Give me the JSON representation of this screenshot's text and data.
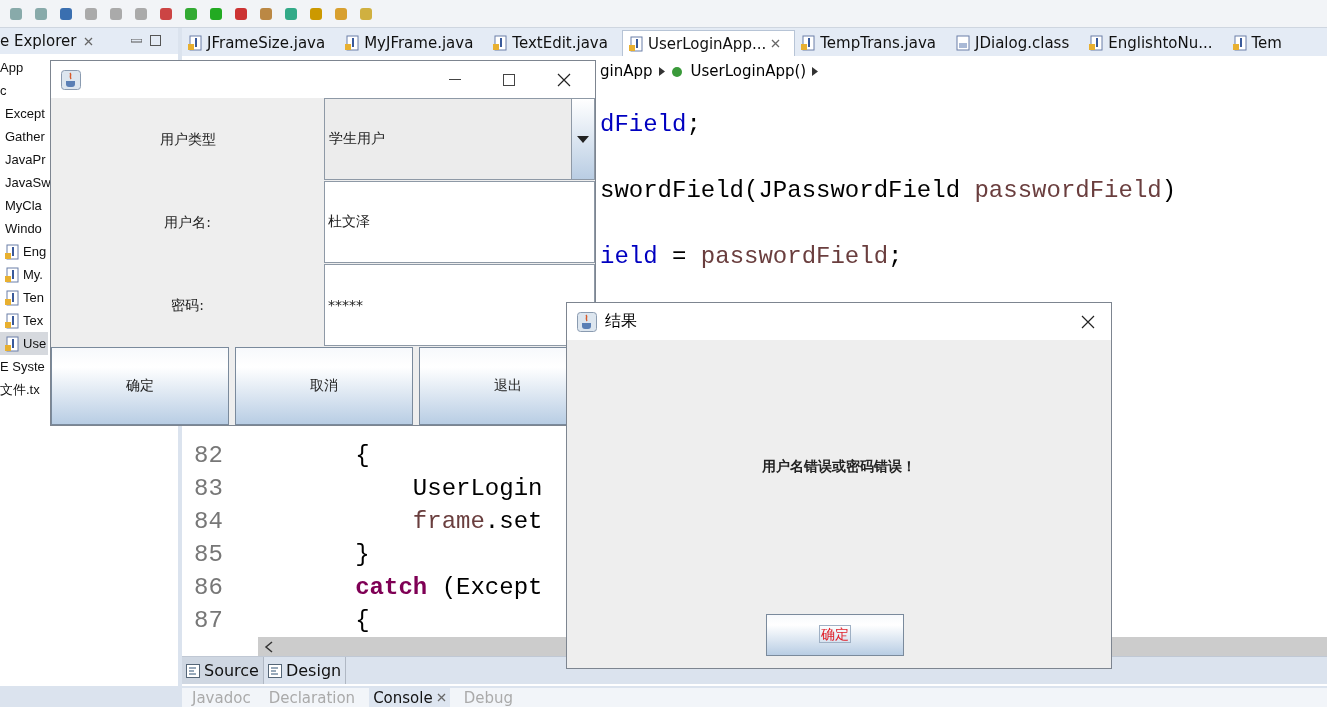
{
  "explorer": {
    "title": "e Explorer",
    "items": [
      {
        "label": "App",
        "selected": false,
        "children": [
          {
            "label": "c",
            "selected": false,
            "children": [
              {
                "label": "Except",
                "selected": false
              },
              {
                "label": "Gather",
                "selected": false
              },
              {
                "label": "JavaPr",
                "selected": false
              },
              {
                "label": "JavaSw",
                "selected": false
              },
              {
                "label": "MyCla",
                "selected": false
              },
              {
                "label": "Windo",
                "selected": false
              },
              {
                "label": "Eng",
                "kind": "java",
                "selected": false
              },
              {
                "label": "My.",
                "kind": "java",
                "selected": false
              },
              {
                "label": "Ten",
                "kind": "java",
                "selected": false
              },
              {
                "label": "Tex",
                "kind": "java",
                "selected": false
              },
              {
                "label": "Use",
                "kind": "java",
                "selected": true
              }
            ]
          },
          {
            "label": "E Syste",
            "selected": false
          },
          {
            "label": "文件.tx",
            "selected": false
          }
        ]
      }
    ]
  },
  "editor_tabs": [
    {
      "label": "JFrameSize.java",
      "kind": "java",
      "selected": false
    },
    {
      "label": "MyJFrame.java",
      "kind": "java",
      "selected": false
    },
    {
      "label": "TextEdit.java",
      "kind": "java",
      "selected": false
    },
    {
      "label": "UserLoginApp...",
      "kind": "java",
      "selected": true
    },
    {
      "label": "TempTrans.java",
      "kind": "java",
      "selected": false
    },
    {
      "label": "JDialog.class",
      "kind": "class",
      "selected": false
    },
    {
      "label": "EnglishtoNu...",
      "kind": "java",
      "selected": false
    },
    {
      "label": "Tem",
      "kind": "java",
      "selected": false
    }
  ],
  "breadcrumb": [
    {
      "label": "ginApp",
      "kind": "class"
    },
    {
      "label": "UserLoginApp()",
      "kind": "constructor"
    }
  ],
  "code": {
    "partial_lines": [
      {
        "segments": [
          {
            "text": "dField",
            "kind": "field"
          },
          {
            "text": ";",
            "kind": "plain"
          }
        ]
      },
      {
        "segments": [
          {
            "text": "swordField(JPasswordField ",
            "kind": "plain"
          },
          {
            "text": "passwordField",
            "kind": "variable"
          },
          {
            "text": ")",
            "kind": "plain"
          }
        ]
      },
      {
        "segments": [
          {
            "text": "ield",
            "kind": "field"
          },
          {
            "text": " = ",
            "kind": "plain"
          },
          {
            "text": "passwordField",
            "kind": "variable"
          },
          {
            "text": ";",
            "kind": "plain"
          }
        ]
      }
    ],
    "lines": [
      {
        "number": "82",
        "segments": [
          {
            "text": "        {",
            "kind": "plain"
          }
        ]
      },
      {
        "number": "83",
        "segments": [
          {
            "text": "            UserLogin",
            "kind": "plain"
          }
        ]
      },
      {
        "number": "84",
        "segments": [
          {
            "text": "            frame",
            "kind": "variable"
          },
          {
            "text": ".set",
            "kind": "plain"
          }
        ]
      },
      {
        "number": "85",
        "segments": [
          {
            "text": "        }",
            "kind": "plain"
          }
        ]
      },
      {
        "number": "86",
        "segments": [
          {
            "text": "        catch",
            "kind": "keyword"
          },
          {
            "text": " (Except",
            "kind": "plain"
          }
        ]
      },
      {
        "number": "87",
        "segments": [
          {
            "text": "        {",
            "kind": "plain"
          }
        ]
      }
    ]
  },
  "editor_mode_tabs": [
    {
      "label": "Source",
      "selected": true
    },
    {
      "label": "Design",
      "selected": false
    }
  ],
  "bottom_tabs": [
    {
      "label": "Javadoc",
      "selected": false
    },
    {
      "label": "Declaration",
      "selected": false
    },
    {
      "label": "Console",
      "selected": true
    },
    {
      "label": "Debug",
      "selected": false
    }
  ],
  "login_window": {
    "fields": [
      {
        "label": "用户类型",
        "kind": "combo",
        "value": "学生用户"
      },
      {
        "label": "用户名:",
        "kind": "text",
        "value": "杜文泽"
      },
      {
        "label": "密码:",
        "kind": "password",
        "value": "*****"
      }
    ],
    "buttons": [
      "确定",
      "取消",
      "退出"
    ]
  },
  "result_dialog": {
    "title": "结果",
    "message": "用户名错误或密码错误！",
    "button": "确定"
  }
}
